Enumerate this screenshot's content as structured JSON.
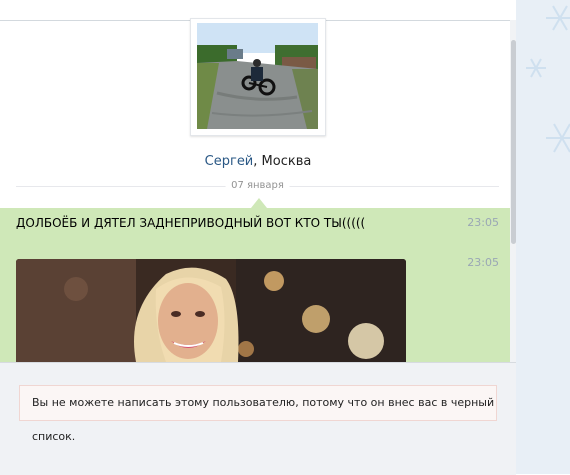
{
  "profile": {
    "name": "Сергей",
    "city_suffix": ", Москва"
  },
  "date_separator": "07 января",
  "messages": [
    {
      "text": "ДОЛБОЁБ И ДЯТЕЛ ЗАДНЕПРИВОДНЫЙ ВОТ КТО ТЫ(((((",
      "time": "23:05"
    },
    {
      "text": "",
      "time": "23:05"
    }
  ],
  "composer": {
    "blocked_notice": "Вы не можете написать этому пользователю, потому что он внес вас в черный список."
  },
  "colors": {
    "message_bg": "#cfe8b8",
    "link": "#2a5885",
    "notice_bg": "#fbf6f5",
    "notice_border": "#f0d6d2"
  }
}
